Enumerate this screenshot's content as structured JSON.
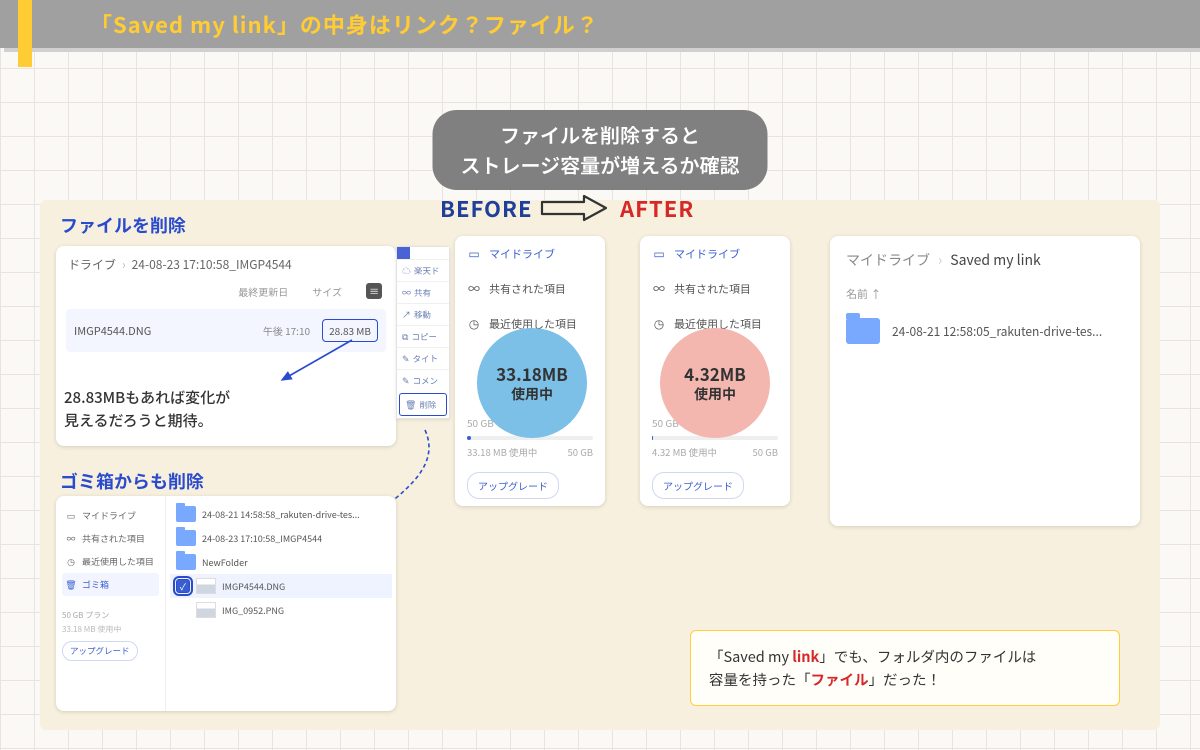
{
  "header": {
    "title": "「Saved my link」の中身はリンク？ファイル？"
  },
  "subheading": "ファイルを削除すると\nストレージ容量が増えるか確認",
  "labels": {
    "delete_files": "ファイルを削除",
    "delete_trash": "ゴミ箱からも削除",
    "before": "BEFORE",
    "after": "AFTER"
  },
  "card_delete": {
    "crumb_root": "ドライブ",
    "crumb_leaf": "24-08-23 17:10:58_IMGP4544",
    "col_modified": "最終更新日",
    "col_size": "サイズ",
    "row_name": "IMGP4544.DNG",
    "row_time": "午後 17:10",
    "row_size": "28.83 MB",
    "note": "28.83MBもあれば変化が\n見えるだろうと期待。"
  },
  "ctx_menu": {
    "rakuten": "楽天ド",
    "share": "共有",
    "move": "移動",
    "copy": "コピー",
    "title_edit": "タイト",
    "comment": "コメン",
    "delete": "削除"
  },
  "card_trash": {
    "side": {
      "mydrive": "マイドライブ",
      "shared": "共有された項目",
      "recent": "最近使用した項目",
      "trash": "ゴミ箱",
      "plan": "50 GB プラン",
      "usage": "33.18 MB 使用中",
      "upgrade": "アップグレード"
    },
    "items": [
      "24-08-21 14:58:58_rakuten-drive-tes...",
      "24-08-23 17:10:58_IMGP4544",
      "NewFolder",
      "IMGP4544.DNG",
      "IMG_0952.PNG"
    ]
  },
  "storage": {
    "mydrive": "マイドライブ",
    "shared": "共有された項目",
    "recent_trunc": "最近使用した項目",
    "plan": "50 GB プラン",
    "cap": "50 GB",
    "upgrade": "アップグレード",
    "before_usage_line": "33.18 MB 使用中",
    "after_usage_line": "4.32 MB 使用中"
  },
  "bubble_before": {
    "value": "33.18MB",
    "unit": "使用中"
  },
  "bubble_after": {
    "value": "4.32MB",
    "unit": "使用中"
  },
  "card_after_drive": {
    "crumb_root": "マイドライブ",
    "crumb_leaf": "Saved my link",
    "col_name": "名前 ↑",
    "item": "24-08-21 12:58:05_rakuten-drive-tes..."
  },
  "conclusion": {
    "p1a": "「Saved my ",
    "p1k": "link",
    "p1b": "」でも、フォルダ内のファイルは",
    "p2a": "容量を持った「",
    "p2k": "ファイル",
    "p2b": "」だった！"
  }
}
